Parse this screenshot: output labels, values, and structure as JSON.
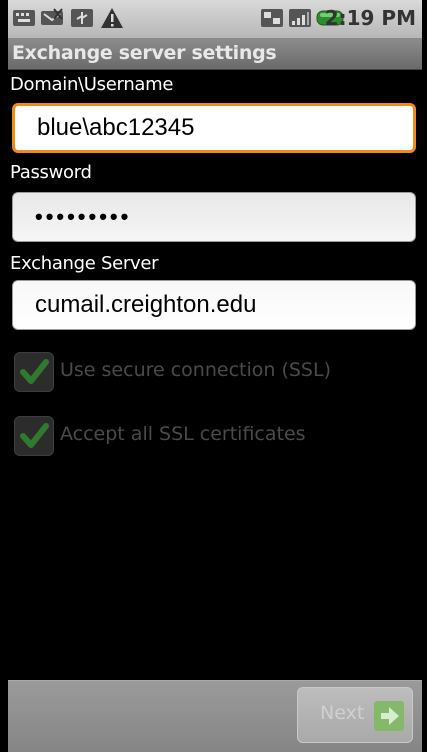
{
  "status_bar": {
    "icons": [
      "keyboard-icon",
      "missed-call-icon",
      "usb-icon",
      "warning-icon",
      "sync-icon",
      "signal-icon",
      "battery-icon"
    ],
    "time": "2:19 PM"
  },
  "screen": {
    "title": "Exchange server settings"
  },
  "form": {
    "username": {
      "label": "Domain\\Username",
      "value": "blue\\abc12345"
    },
    "password": {
      "label": "Password",
      "value": "•••••••••"
    },
    "server": {
      "label": "Exchange Server",
      "value": "cumail.creighton.edu"
    },
    "ssl": {
      "label": "Use secure connection (SSL)",
      "checked": true,
      "enabled": false
    },
    "accept_certs": {
      "label": "Accept all SSL certificates",
      "checked": true,
      "enabled": false
    }
  },
  "footer": {
    "next_label": "Next"
  },
  "colors": {
    "focus": "#f08a18",
    "check": "#3a9a3a"
  }
}
